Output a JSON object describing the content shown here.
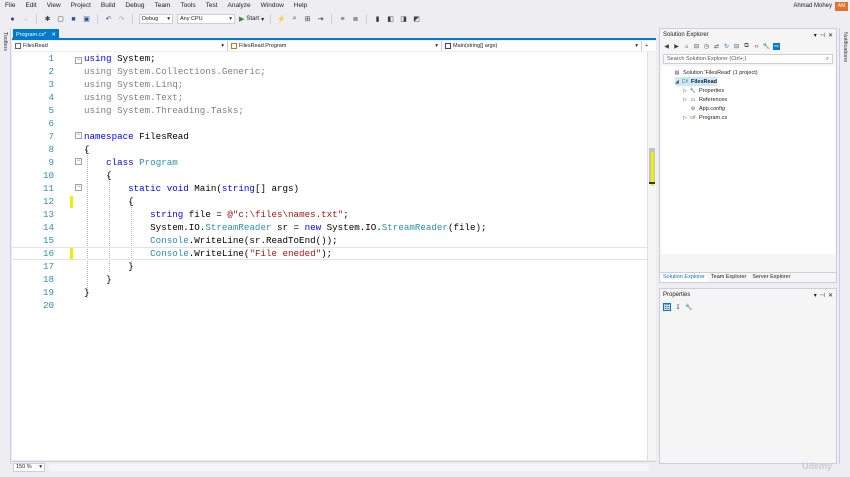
{
  "menu": [
    "File",
    "Edit",
    "View",
    "Project",
    "Build",
    "Debug",
    "Team",
    "Tools",
    "Test",
    "Analyze",
    "Window",
    "Help"
  ],
  "user": {
    "name": "Ahmad Mohey",
    "initials": "AM"
  },
  "toolbar": {
    "config": "Debug",
    "platform": "Any CPU",
    "start_label": "Start"
  },
  "side": {
    "left": "Toolbox",
    "right": "Notifications"
  },
  "editor": {
    "tab_label": "Program.cs*",
    "nav_project": "FilesRead",
    "nav_class": "FilesRead.Program",
    "nav_member": "Main(string[] args)",
    "zoom": "150 %"
  },
  "code_lines": [
    {
      "n": "1",
      "html": "<span class='kw'>using</span> <span class='plain'>System;</span>"
    },
    {
      "n": "2",
      "html": "<span class='gray'>using System.Collections.Generic;</span>"
    },
    {
      "n": "3",
      "html": "<span class='gray'>using System.Linq;</span>"
    },
    {
      "n": "4",
      "html": "<span class='gray'>using System.Text;</span>"
    },
    {
      "n": "5",
      "html": "<span class='gray'>using System.Threading.Tasks;</span>"
    },
    {
      "n": "6",
      "html": ""
    },
    {
      "n": "7",
      "html": "<span class='kw'>namespace</span> <span class='plain'>FilesRead</span>"
    },
    {
      "n": "8",
      "html": "<span class='plain'>{</span>"
    },
    {
      "n": "9",
      "html": "    <span class='kw'>class</span> <span class='ty'>Program</span>"
    },
    {
      "n": "10",
      "html": "    <span class='plain'>{</span>"
    },
    {
      "n": "11",
      "html": "        <span class='kw'>static void</span> <span class='plain'>Main(</span><span class='kw'>string</span><span class='plain'>[] args)</span>"
    },
    {
      "n": "12",
      "html": "        <span class='plain'>{</span>"
    },
    {
      "n": "13",
      "html": "            <span class='kw'>string</span> <span class='plain'>file = </span><span class='str'>@\"c:\\files\\names.txt\"</span><span class='plain'>;</span>"
    },
    {
      "n": "14",
      "html": "            <span class='plain'>System.IO.</span><span class='ty'>StreamReader</span> <span class='plain'>sr = </span><span class='kw'>new</span> <span class='plain'>System.IO.</span><span class='ty'>StreamReader</span><span class='plain'>(file);</span>"
    },
    {
      "n": "15",
      "html": "            <span class='ty'>Console</span><span class='plain'>.WriteLine(sr.ReadToEnd());</span>"
    },
    {
      "n": "16",
      "html": "            <span class='ty'>Console</span><span class='plain'>.WriteLine(</span><span class='str'>\"File eneded\"</span><span class='plain'>);</span>"
    },
    {
      "n": "17",
      "html": "        <span class='plain'>}</span>"
    },
    {
      "n": "18",
      "html": "    <span class='plain'>}</span>"
    },
    {
      "n": "19",
      "html": "<span class='plain'>}</span>"
    },
    {
      "n": "20",
      "html": ""
    }
  ],
  "solution_explorer": {
    "title": "Solution Explorer",
    "search_placeholder": "Search Solution Explorer (Ctrl+;)",
    "tree": [
      {
        "label": "Solution 'FilesRead' (1 project)",
        "indent": 0,
        "icon": "solution-icon",
        "arrow": ""
      },
      {
        "label": "FilesRead",
        "indent": 1,
        "icon": "csharp-project-icon",
        "arrow": "◢",
        "selected": true
      },
      {
        "label": "Properties",
        "indent": 2,
        "icon": "wrench-icon",
        "arrow": "▷"
      },
      {
        "label": "References",
        "indent": 2,
        "icon": "references-icon",
        "arrow": "▷"
      },
      {
        "label": "App.config",
        "indent": 2,
        "icon": "config-file-icon",
        "arrow": ""
      },
      {
        "label": "Program.cs",
        "indent": 2,
        "icon": "csharp-file-icon",
        "arrow": "▷"
      }
    ],
    "tabs": [
      "Solution Explorer",
      "Team Explorer",
      "Server Explorer"
    ]
  },
  "properties": {
    "title": "Properties"
  },
  "watermark": "Udemy"
}
